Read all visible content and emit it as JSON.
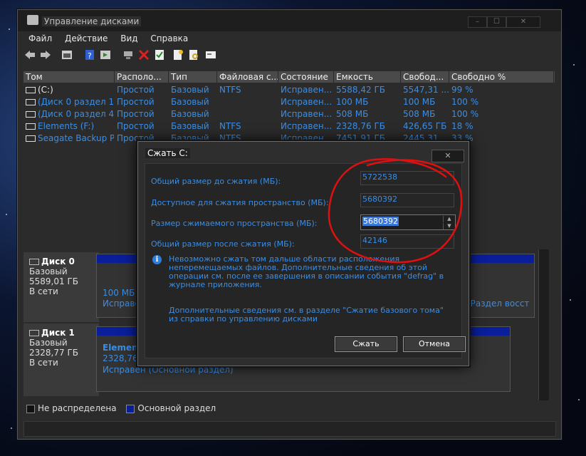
{
  "window": {
    "title": "Управление дисками",
    "buttons": [
      "–",
      "☐",
      "✕"
    ]
  },
  "menu": [
    "Файл",
    "Действие",
    "Вид",
    "Справка"
  ],
  "toolbar": [
    "back-icon",
    "forward-icon",
    "properties-icon",
    "help-icon",
    "refresh-icon",
    "connect-icon",
    "delete-icon",
    "check-icon",
    "new-icon",
    "search-icon",
    "settings-icon"
  ],
  "columns": [
    "Том",
    "Располо...",
    "Тип",
    "Файловая с...",
    "Состояние",
    "Емкость",
    "Свобод...",
    "Свободно %"
  ],
  "volumes": [
    [
      "(C:)",
      "Простой",
      "Базовый",
      "NTFS",
      "Исправен...",
      "5588,42 ГБ",
      "5547,31 ...",
      "99 %"
    ],
    [
      "(Диск 0 раздел 1)",
      "Простой",
      "Базовый",
      "",
      "Исправен...",
      "100 МБ",
      "100 МБ",
      "100 %"
    ],
    [
      "(Диск 0 раздел 4)",
      "Простой",
      "Базовый",
      "",
      "Исправен...",
      "508 МБ",
      "508 МБ",
      "100 %"
    ],
    [
      "Elements (F:)",
      "Простой",
      "Базовый",
      "NTFS",
      "Исправен...",
      "2328,76 ГБ",
      "426,65 ГБ",
      "18 %"
    ],
    [
      "Seagate Backup Pl...",
      "Простой",
      "Базовый",
      "NTFS",
      "Исправен...",
      "7451,91 ГБ",
      "2445,31 ...",
      "33 %"
    ]
  ],
  "disks": [
    {
      "name": "Диск 0",
      "type": "Базовый",
      "size": "5589,01 ГБ",
      "status": "В сети",
      "part_size": "100 МБ",
      "part_status": "Исправен",
      "part_right": "(Раздел восст"
    },
    {
      "name": "Диск 1",
      "type": "Базовый",
      "size": "2328,77 ГБ",
      "status": "В сети",
      "part_name": "Elements",
      "part_size": "2328,76 Г",
      "part_status": "Исправен (Основной раздел)"
    }
  ],
  "legend": {
    "unallocated": "Не распределена",
    "primary": "Основной раздел"
  },
  "dialog": {
    "title": "Сжать C:",
    "close": "✕",
    "total_before_label": "Общий размер до сжатия (МБ):",
    "total_before": "5722538",
    "available_label": "Доступное для сжатия пространство (МБ):",
    "available": "5680392",
    "shrink_label": "Размер сжимаемого пространства (МБ):",
    "shrink_value": "5680392",
    "total_after_label": "Общий размер после сжатия (МБ):",
    "total_after": "42146",
    "info": "Невозможно сжать том дальше области расположения неперемещаемых файлов. Дополнительные сведения об этой операции см. после ее завершения в описании события \"defrag\" в журнале приложения.",
    "more": "Дополнительные сведения см. в разделе \"Сжатие базового тома\" из справки по управлению дисками",
    "ok": "Сжать",
    "cancel": "Отмена"
  },
  "colors": {
    "accent": "#3a8ee6",
    "primary_partition": "#0a1e9a",
    "annotation": "#e01010"
  }
}
